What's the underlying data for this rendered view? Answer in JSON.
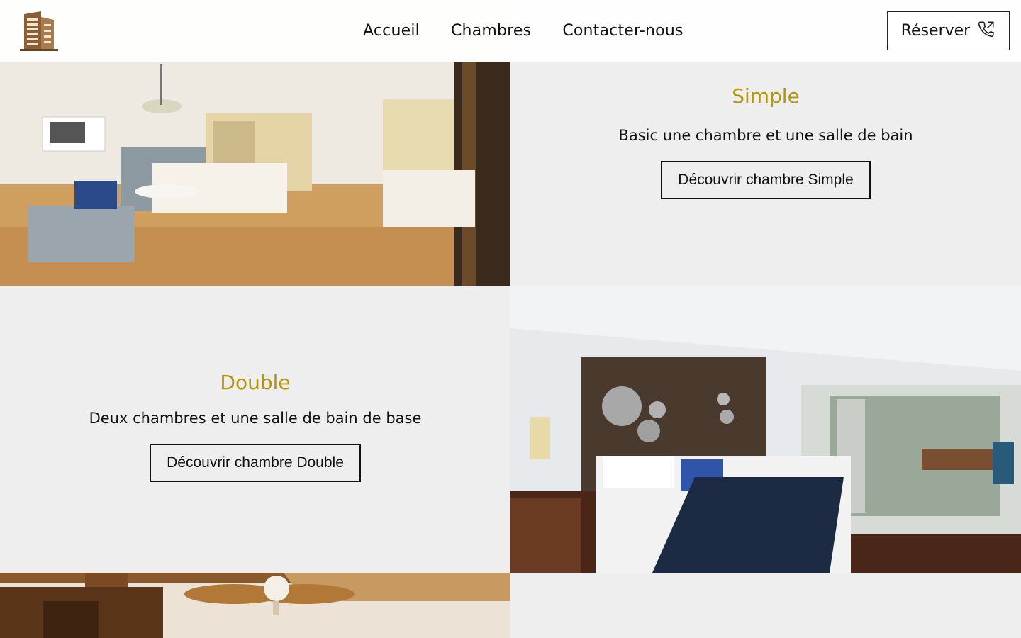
{
  "header": {
    "logo_icon": "hotel-building-icon",
    "nav": [
      {
        "label": "Accueil"
      },
      {
        "label": "Chambres"
      },
      {
        "label": "Contacter-nous"
      }
    ],
    "reserve_label": "Réserver",
    "reserve_icon": "phone-call-icon"
  },
  "rooms": [
    {
      "title": "Simple",
      "description": "Basic une chambre et une salle de bain",
      "button": "Découvrir chambre Simple"
    },
    {
      "title": "Double",
      "description": "Deux chambres et une salle de bain de base",
      "button": "Découvrir chambre Double"
    }
  ],
  "colors": {
    "accent": "#b2960b",
    "panel_background": "#eeeeee",
    "logo_brown": "#8b5e34"
  }
}
